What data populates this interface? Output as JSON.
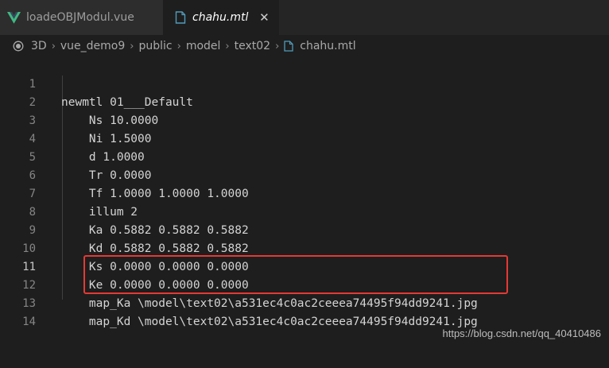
{
  "tabs": [
    {
      "label": "loadeOBJModul.vue",
      "active": false
    },
    {
      "label": "chahu.mtl",
      "active": true
    }
  ],
  "tab_close_glyph": "✕",
  "breadcrumb": [
    "3D",
    "vue_demo9",
    "public",
    "model",
    "text02",
    "chahu.mtl"
  ],
  "breadcrumb_separator": "›",
  "editor": {
    "current_line": 11,
    "lines": [
      {
        "n": "1",
        "text": "newmtl 01___Default"
      },
      {
        "n": "2",
        "text": "    Ns 10.0000"
      },
      {
        "n": "3",
        "text": "    Ni 1.5000"
      },
      {
        "n": "4",
        "text": "    d 1.0000"
      },
      {
        "n": "5",
        "text": "    Tr 0.0000"
      },
      {
        "n": "6",
        "text": "    Tf 1.0000 1.0000 1.0000"
      },
      {
        "n": "7",
        "text": "    illum 2"
      },
      {
        "n": "8",
        "text": "    Ka 0.5882 0.5882 0.5882"
      },
      {
        "n": "9",
        "text": "    Kd 0.5882 0.5882 0.5882"
      },
      {
        "n": "10",
        "text": "    Ks 0.0000 0.0000 0.0000"
      },
      {
        "n": "11",
        "text": "    Ke 0.0000 0.0000 0.0000"
      },
      {
        "n": "12",
        "text": "    map_Ka \\model\\text02\\a531ec4c0ac2ceeea74495f94dd9241.jpg"
      },
      {
        "n": "13",
        "text": "    map_Kd \\model\\text02\\a531ec4c0ac2ceeea74495f94dd9241.jpg"
      },
      {
        "n": "14",
        "text": ""
      }
    ]
  },
  "watermark": "https://blog.csdn.net/qq_40410486",
  "colors": {
    "background": "#1e1e1e",
    "tab_inactive": "#2d2d2d",
    "vue_green": "#41b883",
    "file_icon_blue": "#519aba",
    "annotation_red": "#e53935"
  },
  "icons": {
    "vue_tab": "vue-logo-icon",
    "mtl_tab": "file-icon",
    "breadcrumb_root": "radio-icon",
    "breadcrumb_file": "file-icon"
  }
}
